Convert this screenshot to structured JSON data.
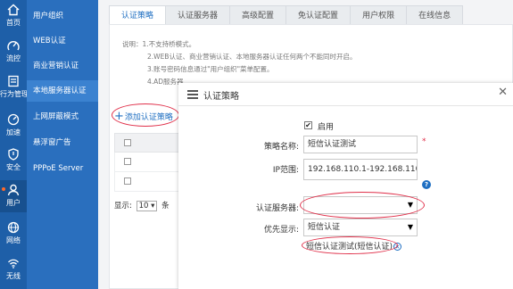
{
  "rail": [
    {
      "label": "首页",
      "icon": "home-icon"
    },
    {
      "label": "流控",
      "icon": "flow-control-icon"
    },
    {
      "label": "行为管理",
      "icon": "behavior-management-icon"
    },
    {
      "label": "加速",
      "icon": "speedometer-icon"
    },
    {
      "label": "安全",
      "icon": "shield-icon"
    },
    {
      "label": "用户",
      "icon": "user-icon"
    },
    {
      "label": "网络",
      "icon": "globe-icon"
    },
    {
      "label": "无线",
      "icon": "wifi-icon"
    }
  ],
  "submenu": [
    "用户组织",
    "WEB认证",
    "商业营销认证",
    "本地服务器认证",
    "上网屏蔽模式",
    "悬浮窗广告",
    "PPPoE Server"
  ],
  "tabs": [
    "认证策略",
    "认证服务器",
    "高级配置",
    "免认证配置",
    "用户权限",
    "在线信息"
  ],
  "notes": [
    "说明：1.不支持桥模式。",
    "2.WEB认证、商业营销认证、本地服务器认证任何两个不能同时开启。",
    "3.账号密码信息通过\"用户组织\"菜单配置。",
    "4.AD服务器"
  ],
  "add_policy": "添加认证策略",
  "pager": {
    "prefix": "显示:",
    "size": "10",
    "suffix": "条"
  },
  "dialog": {
    "title": "认证策略",
    "enable_label": "启用",
    "name_label": "策略名称:",
    "name_value": "短信认证测试",
    "ip_label": "IP范围:",
    "ip_value": "192.168.110.1-192.168.110.100",
    "server_label": "认证服务器:",
    "server_value": "",
    "priority_label": "优先显示:",
    "priority_value": "短信认证",
    "selected_tag": "短信认证测试(短信认证)",
    "required_mark": "*"
  },
  "colors": {
    "rail": "#1e5fa8",
    "submenu": "#2a6fbe",
    "accent": "#1f6fc2",
    "annotation": "#e0304a"
  }
}
